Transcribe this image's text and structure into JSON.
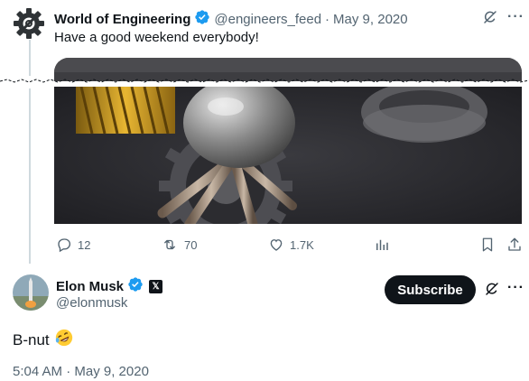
{
  "quoted_tweet": {
    "author_name": "World of Engineering",
    "handle": "@engineers_feed",
    "separator": "·",
    "date": "May 9, 2020",
    "text": "Have a good weekend everybody!",
    "avatar_icon": "gear-logo-icon",
    "image_alt": "metal gear with welded rods and spring"
  },
  "actions": {
    "replies": "12",
    "retweets": "70",
    "likes": "1.7K"
  },
  "main_tweet": {
    "author_name": "Elon Musk",
    "handle": "@elonmusk",
    "affiliate_badge": "𝕏",
    "subscribe_label": "Subscribe",
    "text": "B-nut",
    "emoji": "rolling-on-floor-laughing",
    "timestamp": "5:04 AM · May 9, 2020"
  },
  "colors": {
    "verified_blue": "#1d9bf0",
    "text_primary": "#0f1419",
    "text_secondary": "#536471",
    "thread_line": "#cfd9de",
    "button_dark": "#0f1419"
  }
}
